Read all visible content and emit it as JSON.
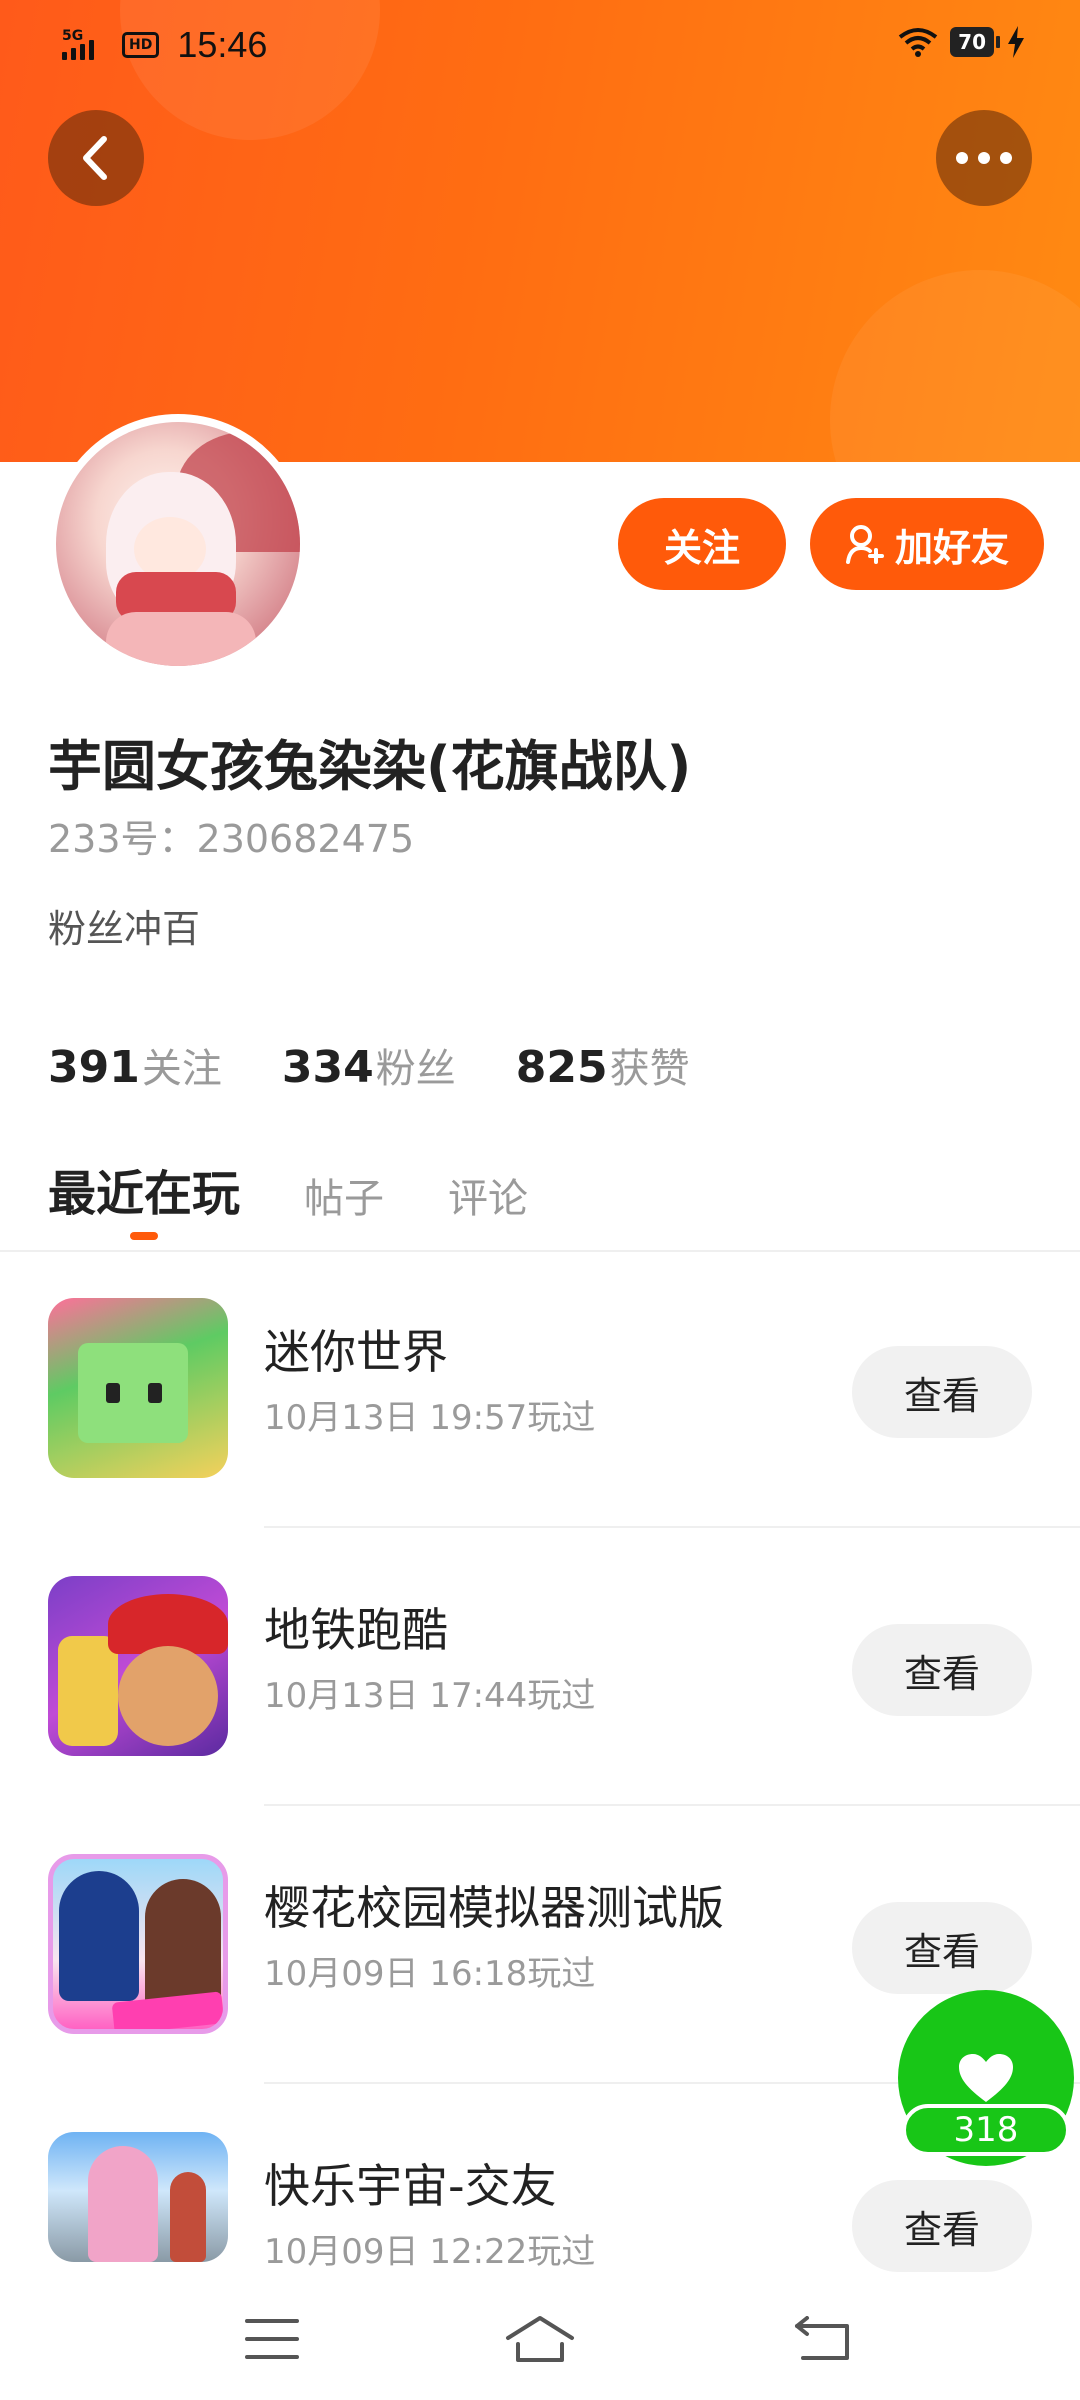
{
  "status_bar": {
    "network": "5G",
    "hd": "HD",
    "time": "15:46",
    "battery": "70"
  },
  "icons": {
    "back": "chevron-left-icon",
    "more": "more-dots-icon",
    "add_friend": "add-user-icon",
    "like": "heart-icon",
    "nav_menu": "menu-icon",
    "nav_home": "home-icon",
    "nav_back": "back-icon"
  },
  "colors": {
    "brand": "#ff5a0a",
    "like": "#18c617"
  },
  "profile": {
    "follow_label": "关注",
    "add_friend_label": "加好友",
    "username": "芋圆女孩兔染染(花旗战队)",
    "uid_text": "233号：230682475",
    "bio": "粉丝冲百",
    "stats": [
      {
        "num": "391",
        "label": "关注"
      },
      {
        "num": "334",
        "label": "粉丝"
      },
      {
        "num": "825",
        "label": "获赞"
      }
    ]
  },
  "tabs": [
    {
      "label": "最近在玩",
      "active": true
    },
    {
      "label": "帖子",
      "active": false
    },
    {
      "label": "评论",
      "active": false
    }
  ],
  "games": [
    {
      "name": "迷你世界",
      "time": "10月13日 19:57玩过",
      "action": "查看"
    },
    {
      "name": "地铁跑酷",
      "time": "10月13日 17:44玩过",
      "action": "查看"
    },
    {
      "name": "樱花校园模拟器测试版",
      "time": "10月09日 16:18玩过",
      "action": "查看"
    },
    {
      "name": "快乐宇宙-交友",
      "time": "10月09日 12:22玩过",
      "action": "查看"
    }
  ],
  "like": {
    "count": "318"
  }
}
